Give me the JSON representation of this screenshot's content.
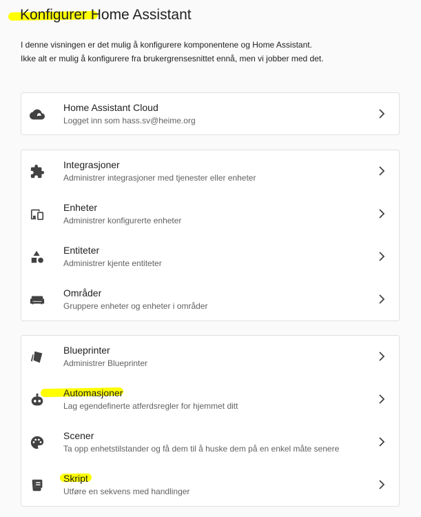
{
  "header": {
    "title": "Konfigurer Home Assistant",
    "intro": "I denne visningen er det mulig å konfigurere komponentene og Home Assistant. Ikke alt er mulig å konfigurere fra brukergrensesnittet ennå, men vi jobber med det."
  },
  "cloud_card": {
    "items": [
      {
        "label": "Home Assistant Cloud",
        "description": "Logget inn som hass.sv@heime.org",
        "icon": "cloud-lock-icon"
      }
    ]
  },
  "devices_card": {
    "items": [
      {
        "label": "Integrasjoner",
        "description": "Administrer integrasjoner med tjenester eller enheter",
        "icon": "puzzle-icon"
      },
      {
        "label": "Enheter",
        "description": "Administrer konfigurerte enheter",
        "icon": "devices-icon"
      },
      {
        "label": "Entiteter",
        "description": "Administrer kjente entiteter",
        "icon": "shape-icon"
      },
      {
        "label": "Områder",
        "description": "Gruppere enheter og enheter i områder",
        "icon": "sofa-icon"
      }
    ]
  },
  "automation_card": {
    "items": [
      {
        "label": "Blueprinter",
        "description": "Administrer Blueprinter",
        "icon": "blueprint-icon"
      },
      {
        "label": "Automasjoner",
        "description": "Lag egendefinerte atferdsregler for hjemmet ditt",
        "icon": "robot-icon"
      },
      {
        "label": "Scener",
        "description": "Ta opp enhetstilstander og få dem til å huske dem på en enkel måte senere",
        "icon": "palette-icon"
      },
      {
        "label": "Skript",
        "description": "Utføre en sekvens med handlinger",
        "icon": "script-icon"
      }
    ]
  },
  "colors": {
    "highlight": "#ffff00",
    "icon": "#424242",
    "card_border": "#e0e0e0"
  }
}
